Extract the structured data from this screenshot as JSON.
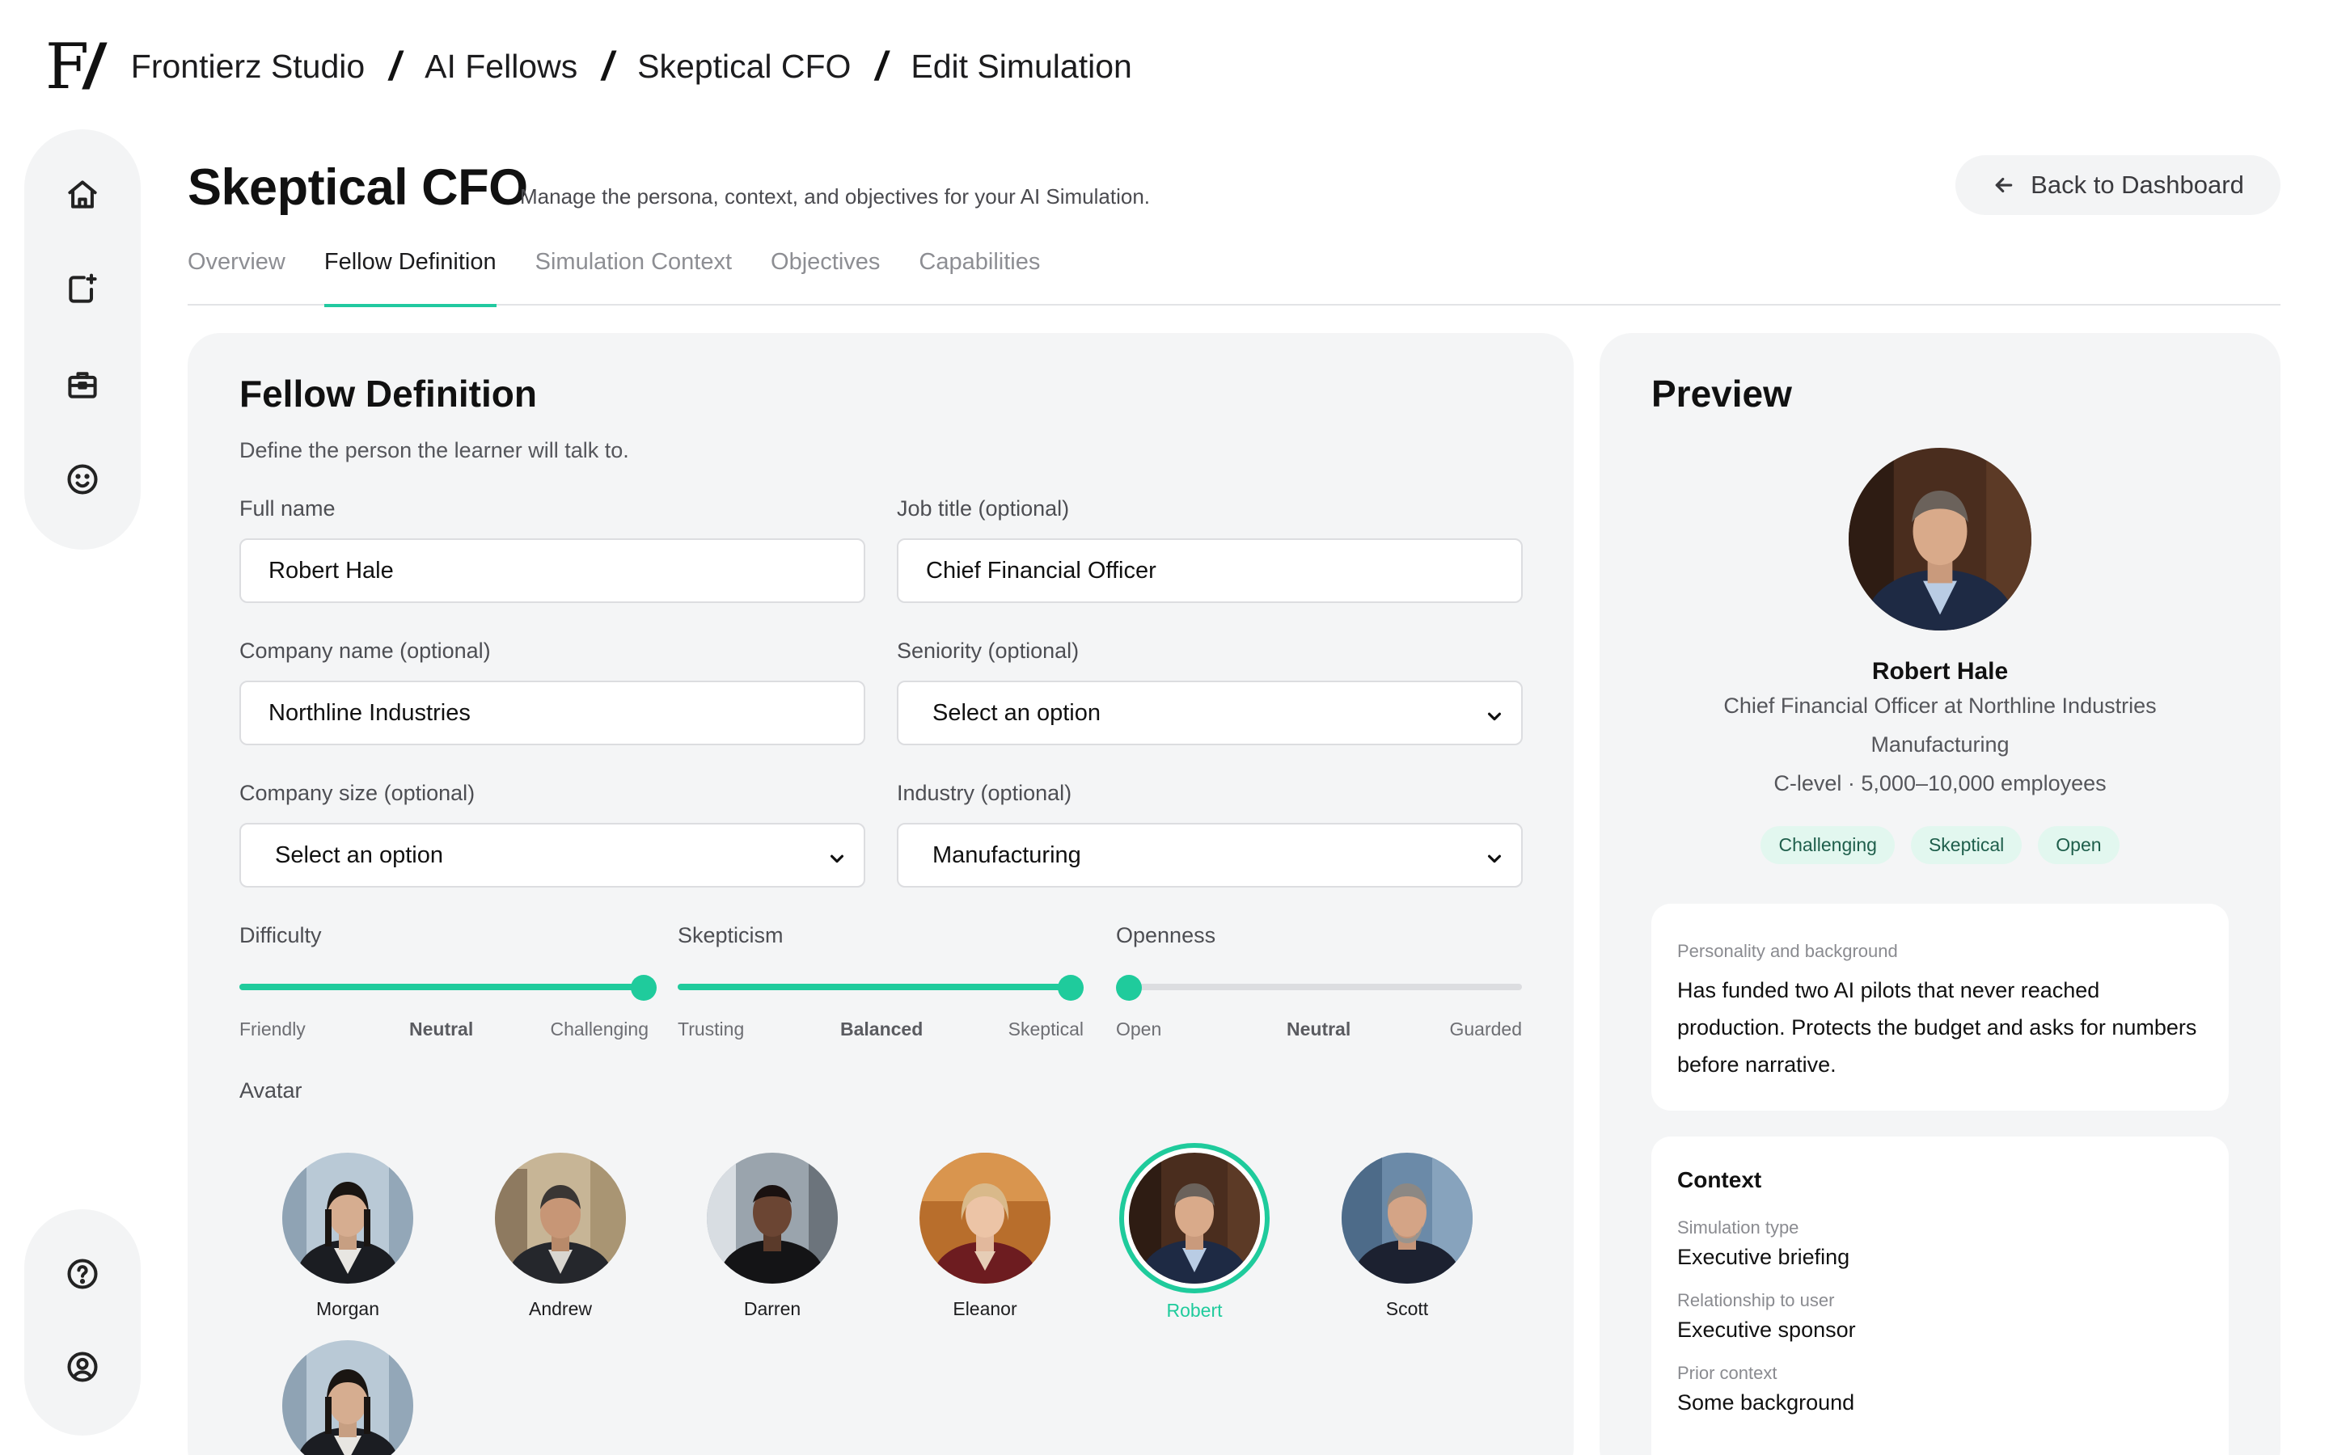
{
  "breadcrumb": {
    "logo_text": "F",
    "logo_slash": "/",
    "items": [
      "Frontierz Studio",
      "AI Fellows",
      "Skeptical CFO",
      "Edit Simulation"
    ],
    "separator": "/"
  },
  "sidebar": {
    "top_icons": [
      "home-icon",
      "new-simulation-icon",
      "briefcase-icon",
      "smile-icon"
    ],
    "bottom_icons": [
      "help-icon",
      "user-icon"
    ]
  },
  "page": {
    "title": "Skeptical CFO",
    "subtitle": "Manage the persona, context, and objectives for your AI Simulation.",
    "back_label": "Back to Dashboard"
  },
  "tabs": [
    {
      "label": "Overview",
      "active": false
    },
    {
      "label": "Fellow Definition",
      "active": true
    },
    {
      "label": "Simulation Context",
      "active": false
    },
    {
      "label": "Objectives",
      "active": false
    },
    {
      "label": "Capabilities",
      "active": false
    }
  ],
  "form": {
    "title": "Fellow Definition",
    "subtitle": "Define the person the learner will talk to.",
    "full_name": {
      "label": "Full name",
      "value": "Robert Hale"
    },
    "job_title": {
      "label": "Job title (optional)",
      "value": "Chief Financial Officer"
    },
    "company_name": {
      "label": "Company name (optional)",
      "value": "Northline Industries"
    },
    "seniority": {
      "label": "Seniority (optional)",
      "value": "Select an option"
    },
    "company_size": {
      "label": "Company size (optional)",
      "value": "Select an option"
    },
    "industry": {
      "label": "Industry (optional)",
      "value": "Manufacturing"
    },
    "sliders": {
      "difficulty": {
        "label": "Difficulty",
        "value": 1.0,
        "left": "Friendly",
        "mid": "Neutral",
        "right": "Challenging"
      },
      "skepticism": {
        "label": "Skepticism",
        "value": 1.0,
        "left": "Trusting",
        "mid": "Balanced",
        "right": "Skeptical"
      },
      "openness": {
        "label": "Openness",
        "value": 0.0,
        "left": "Open",
        "mid": "Neutral",
        "right": "Guarded"
      }
    },
    "avatar_label": "Avatar",
    "avatars": [
      "Morgan",
      "Andrew",
      "Darren",
      "Eleanor",
      "Robert",
      "Scott"
    ],
    "selected_avatar": "Robert"
  },
  "preview": {
    "title": "Preview",
    "name": "Robert Hale",
    "role_line": "Chief Financial Officer at Northline Industries",
    "industry": "Manufacturing",
    "meta_line": "C-level · 5,000–10,000 employees",
    "chips": [
      "Challenging",
      "Skeptical",
      "Open"
    ],
    "personality_label": "Personality and background",
    "personality_text": "Has funded two AI pilots that never reached production. Protects the budget and asks for numbers before narrative.",
    "context": {
      "heading": "Context",
      "sim_type_label": "Simulation type",
      "sim_type_value": "Executive briefing",
      "relationship_label": "Relationship to user",
      "relationship_value": "Executive sponsor",
      "prior_label": "Prior context",
      "prior_value": "Some background"
    }
  },
  "colors": {
    "accent": "#1fcb9c",
    "panel": "#f4f5f6",
    "chip_bg": "#e2f7ef"
  }
}
